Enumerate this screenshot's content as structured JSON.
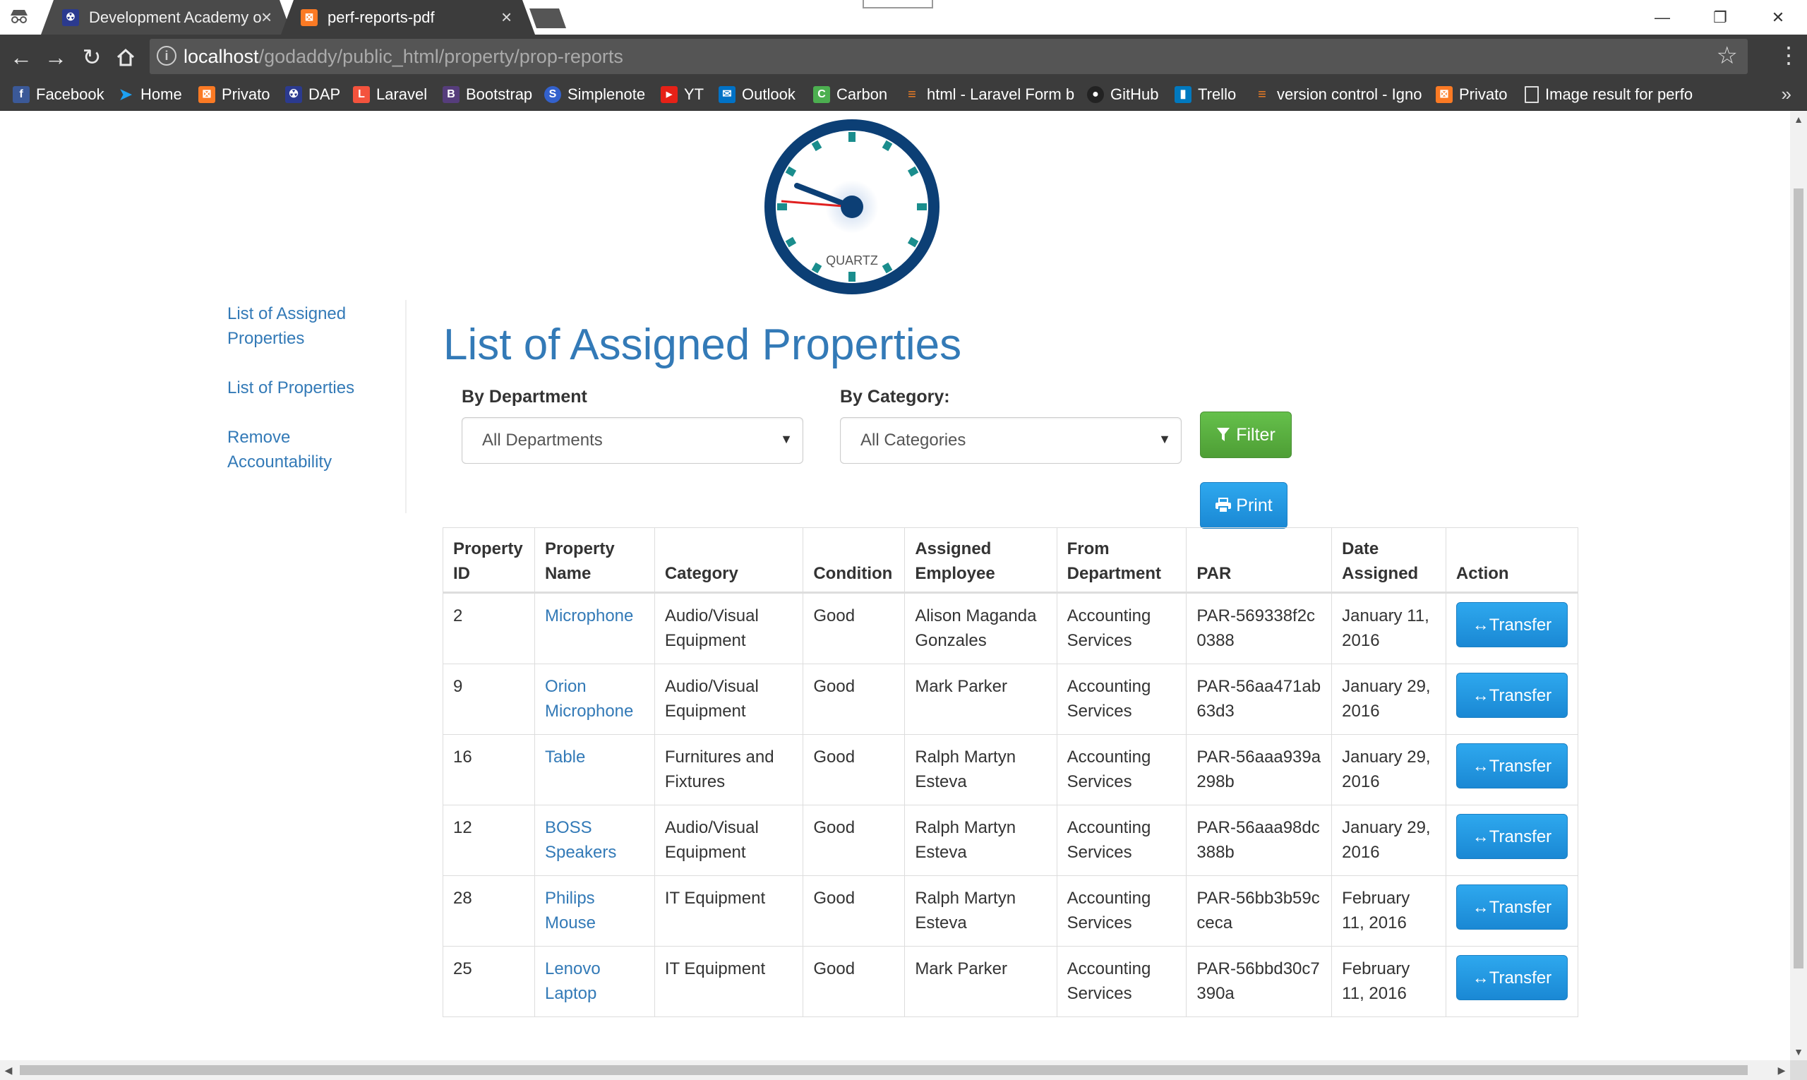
{
  "browser": {
    "tabs": [
      {
        "title": "Development Academy o",
        "favicon": "dap-icon",
        "active": false
      },
      {
        "title": "perf-reports-pdf",
        "favicon": "xampp-icon",
        "active": true
      }
    ],
    "url_host": "localhost",
    "url_path": "/godaddy/public_html/property/prop-reports",
    "bookmarks": [
      {
        "label": "Facebook",
        "icon": "facebook-icon",
        "color": "#3b5998"
      },
      {
        "label": "Home",
        "icon": "twitter-icon",
        "color": "#1da1f2"
      },
      {
        "label": "Privato",
        "icon": "xampp-icon",
        "color": "#fb7a24"
      },
      {
        "label": "DAP",
        "icon": "dap-icon",
        "color": "#2b3a8f"
      },
      {
        "label": "Laravel",
        "icon": "laravel-icon",
        "color": "#f4533d"
      },
      {
        "label": "Bootstrap",
        "icon": "bootstrap-icon",
        "color": "#563d7c"
      },
      {
        "label": "Simplenote",
        "icon": "simplenote-icon",
        "color": "#3361cc"
      },
      {
        "label": "YT",
        "icon": "youtube-icon",
        "color": "#e62117"
      },
      {
        "label": "Outlook",
        "icon": "outlook-icon",
        "color": "#0072c6"
      },
      {
        "label": "Carbon",
        "icon": "carbon-icon",
        "color": "#4caf50"
      },
      {
        "label": "html - Laravel Form b",
        "icon": "stackoverflow-icon",
        "color": "#f48024"
      },
      {
        "label": "GitHub",
        "icon": "github-icon",
        "color": "#222222"
      },
      {
        "label": "Trello",
        "icon": "trello-icon",
        "color": "#0079bf"
      },
      {
        "label": "version control - Igno",
        "icon": "stackoverflow-icon",
        "color": "#f48024"
      },
      {
        "label": "Privato",
        "icon": "xampp-icon",
        "color": "#fb7a24"
      },
      {
        "label": "Image result for perfo",
        "icon": "page-icon",
        "color": "#ffffff"
      }
    ],
    "more_symbol": "»"
  },
  "logo": {
    "text": "QUARTZ"
  },
  "sidebar": {
    "items": [
      {
        "label": "List of Assigned Properties"
      },
      {
        "label": "List of Properties"
      },
      {
        "label": "Remove Accountability"
      }
    ]
  },
  "page_title": "List of Assigned Properties",
  "filters": {
    "department_label": "By Department",
    "department_value": "All Departments",
    "category_label": "By Category:",
    "category_value": "All Categories",
    "filter_button": "Filter",
    "print_button": "Print"
  },
  "table": {
    "headers": [
      "Property ID",
      "Property Name",
      "Category",
      "Condition",
      "Assigned Employee",
      "From Department",
      "PAR",
      "Date Assigned",
      "Action"
    ],
    "rows": [
      {
        "id": "2",
        "name": "Microphone",
        "category": "Audio/Visual Equipment",
        "condition": "Good",
        "employee": "Alison Maganda Gonzales",
        "department": "Accounting Services",
        "par": "PAR-569338f2c0388",
        "date": "January 11, 2016",
        "action": "↔Transfer"
      },
      {
        "id": "9",
        "name": "Orion Microphone",
        "category": "Audio/Visual Equipment",
        "condition": "Good",
        "employee": "Mark Parker",
        "department": "Accounting Services",
        "par": "PAR-56aa471ab63d3",
        "date": "January 29, 2016",
        "action": "↔Transfer"
      },
      {
        "id": "16",
        "name": "Table",
        "category": "Furnitures and Fixtures",
        "condition": "Good",
        "employee": "Ralph Martyn Esteva",
        "department": "Accounting Services",
        "par": "PAR-56aaa939a298b",
        "date": "January 29, 2016",
        "action": "↔Transfer"
      },
      {
        "id": "12",
        "name": "BOSS Speakers",
        "category": "Audio/Visual Equipment",
        "condition": "Good",
        "employee": "Ralph Martyn Esteva",
        "department": "Accounting Services",
        "par": "PAR-56aaa98dc388b",
        "date": "January 29, 2016",
        "action": "↔Transfer"
      },
      {
        "id": "28",
        "name": "Philips Mouse",
        "category": "IT Equipment",
        "condition": "Good",
        "employee": "Ralph Martyn Esteva",
        "department": "Accounting Services",
        "par": "PAR-56bb3b59cceca",
        "date": "February 11, 2016",
        "action": "↔Transfer"
      },
      {
        "id": "25",
        "name": "Lenovo Laptop",
        "category": "IT Equipment",
        "condition": "Good",
        "employee": "Mark Parker",
        "department": "Accounting Services",
        "par": "PAR-56bbd30c7390a",
        "date": "February 11, 2016",
        "action": "↔Transfer"
      }
    ]
  },
  "colors": {
    "link": "#337ab7",
    "filter_button": "#5cb85c",
    "print_button": "#1e95e0",
    "transfer_button": "#1e95e0"
  }
}
